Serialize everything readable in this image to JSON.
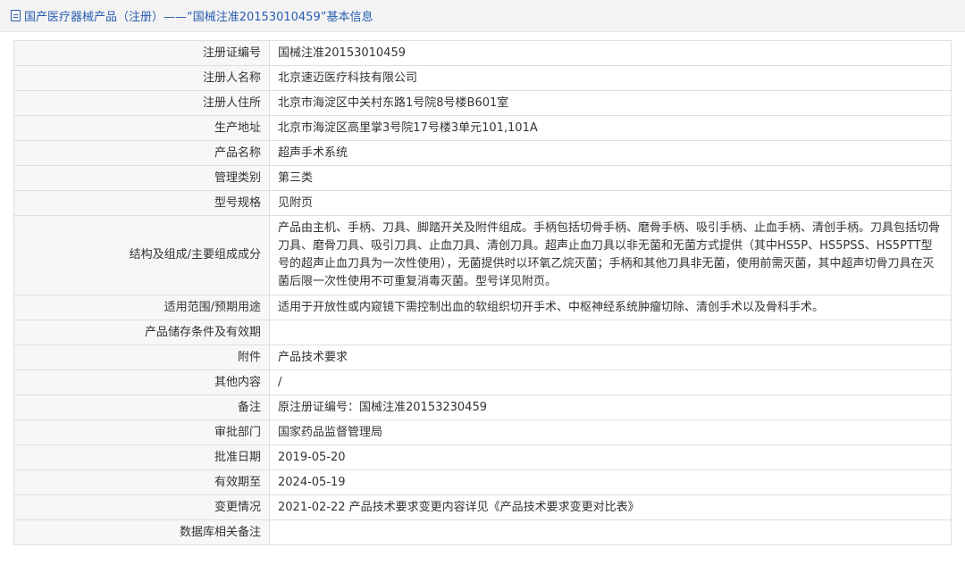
{
  "header": {
    "title": "国产医疗器械产品（注册）——“国械注准20153010459”基本信息"
  },
  "rows": [
    {
      "label": "注册证编号",
      "value": "国械注准20153010459"
    },
    {
      "label": "注册人名称",
      "value": "北京速迈医疗科技有限公司"
    },
    {
      "label": "注册人住所",
      "value": "北京市海淀区中关村东路1号院8号楼B601室"
    },
    {
      "label": "生产地址",
      "value": "北京市海淀区高里掌3号院17号楼3单元101,101A"
    },
    {
      "label": "产品名称",
      "value": "超声手术系统"
    },
    {
      "label": "管理类别",
      "value": "第三类"
    },
    {
      "label": "型号规格",
      "value": "见附页"
    },
    {
      "label": "结构及组成/主要组成成分",
      "value": "产品由主机、手柄、刀具、脚踏开关及附件组成。手柄包括切骨手柄、磨骨手柄、吸引手柄、止血手柄、清创手柄。刀具包括切骨刀具、磨骨刀具、吸引刀具、止血刀具、清创刀具。超声止血刀具以非无菌和无菌方式提供（其中HS5P、HS5PSS、HS5PTT型号的超声止血刀具为一次性使用），无菌提供时以环氧乙烷灭菌；手柄和其他刀具非无菌，使用前需灭菌，其中超声切骨刀具在灭菌后限一次性使用不可重复消毒灭菌。型号详见附页。"
    },
    {
      "label": "适用范围/预期用途",
      "value": "适用于开放性或内窥镜下需控制出血的软组织切开手术、中枢神经系统肿瘤切除、清创手术以及骨科手术。"
    },
    {
      "label": "产品储存条件及有效期",
      "value": ""
    },
    {
      "label": "附件",
      "value": "产品技术要求"
    },
    {
      "label": "其他内容",
      "value": "/"
    },
    {
      "label": "备注",
      "value": "原注册证编号：国械注准20153230459"
    },
    {
      "label": "审批部门",
      "value": "国家药品监督管理局"
    },
    {
      "label": "批准日期",
      "value": "2019-05-20"
    },
    {
      "label": "有效期至",
      "value": "2024-05-19"
    },
    {
      "label": "变更情况",
      "value": "2021-02-22 产品技术要求变更内容详见《产品技术要求变更对比表》"
    },
    {
      "label": "数据库相关备注",
      "value": ""
    }
  ]
}
